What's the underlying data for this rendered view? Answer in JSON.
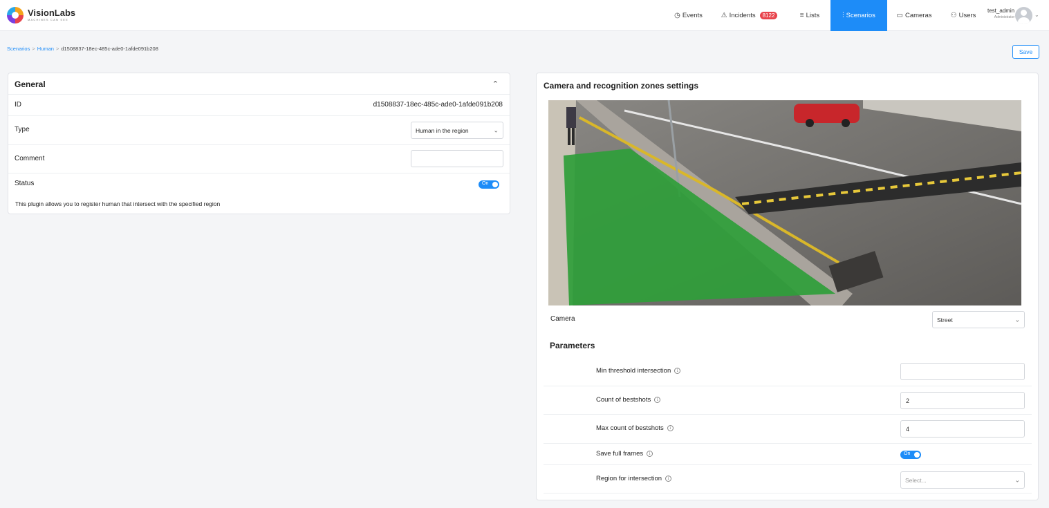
{
  "app": {
    "brand": "VisionLabs",
    "tagline": "MACHINES CAN SEE"
  },
  "nav": {
    "events": "Events",
    "incidents": "Incidents",
    "incidents_count": "8122",
    "lists": "Lists",
    "scenarios": "Scenarios",
    "cameras": "Cameras",
    "users": "Users"
  },
  "user": {
    "name": "test_admin",
    "role": "Administrator"
  },
  "breadcrumb": {
    "root": "Scenarios",
    "parent": "Human",
    "current": "d1508837-18ec-485c-ade0-1afde091b208"
  },
  "toolbar": {
    "save_label": "Save"
  },
  "general": {
    "title": "General",
    "id_label": "ID",
    "id_value": "d1508837-18ec-485c-ade0-1afde091b208",
    "type_label": "Type",
    "type_value": "Human in the region",
    "comment_label": "Comment",
    "comment_value": "",
    "status_label": "Status",
    "status_toggle": "On",
    "description": "This plugin allows you to register human that intersect with the specified region"
  },
  "camera_settings": {
    "title": "Camera and recognition zones settings",
    "camera_label": "Camera",
    "camera_value": "Street",
    "zone_color": "#2f9e3a"
  },
  "parameters": {
    "title": "Parameters",
    "min_threshold_label": "Min threshold intersection",
    "min_threshold_value": "",
    "count_bestshots_label": "Count of bestshots",
    "count_bestshots_value": "2",
    "max_count_label": "Max count of bestshots",
    "max_count_value": "4",
    "save_frames_label": "Save full frames",
    "save_frames_toggle": "On",
    "region_label": "Region for intersection",
    "region_placeholder": "Select..."
  },
  "icons": {
    "events": "clock-icon",
    "incidents": "warning-icon",
    "lists": "list-icon",
    "scenarios": "sliders-icon",
    "cameras": "camera-icon",
    "users": "users-icon"
  },
  "colors": {
    "accent": "#1d8cf8",
    "badge": "#e8434b"
  }
}
